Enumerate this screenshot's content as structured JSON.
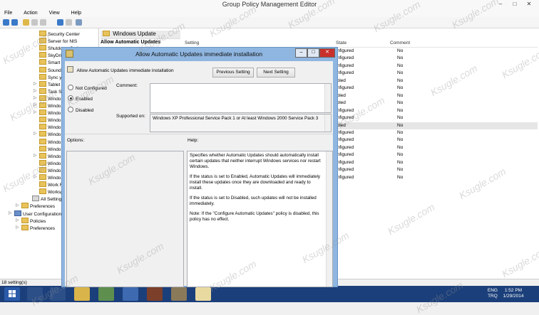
{
  "window": {
    "title": "Group Policy Management Editor",
    "controls": [
      "–",
      "□",
      "✕"
    ]
  },
  "menu": [
    "File",
    "Action",
    "View",
    "Help"
  ],
  "tree": {
    "items": [
      {
        "label": "Security Center"
      },
      {
        "label": "Server for NIS"
      },
      {
        "label": "Shutdown Options"
      },
      {
        "label": "SkyDrive"
      },
      {
        "label": "Smart"
      },
      {
        "label": "Sound"
      },
      {
        "label": "Sync y"
      },
      {
        "label": "Tablet"
      },
      {
        "label": "Task S"
      },
      {
        "label": "Windo"
      },
      {
        "label": "Windo"
      },
      {
        "label": "Windo"
      },
      {
        "label": "Windo"
      },
      {
        "label": "Windo"
      },
      {
        "label": "Windo"
      },
      {
        "label": "Windo"
      },
      {
        "label": "Windo"
      },
      {
        "label": "Windo"
      },
      {
        "label": "Windo"
      },
      {
        "label": "Windo"
      },
      {
        "label": "Windo"
      },
      {
        "label": "Work F"
      },
      {
        "label": "Worksp"
      },
      {
        "label": "All Setting"
      },
      {
        "label": "Preferences"
      },
      {
        "label": "User Configuration"
      },
      {
        "label": "Policies"
      },
      {
        "label": "Preferences"
      }
    ]
  },
  "right": {
    "category": "Windows Update",
    "selected_title": "Allow Automatic Updates",
    "columns": {
      "setting": "Setting",
      "state": "State",
      "comment": "Comment"
    },
    "rows": [
      {
        "state": "onfigured",
        "comment": "No"
      },
      {
        "state": "onfigured",
        "comment": "No"
      },
      {
        "state": "onfigured",
        "comment": "No"
      },
      {
        "state": "onfigured",
        "comment": "No"
      },
      {
        "state": "abled",
        "comment": "No"
      },
      {
        "state": "onfigured",
        "comment": "No"
      },
      {
        "state": "abled",
        "comment": "No"
      },
      {
        "state": "abled",
        "comment": "No"
      },
      {
        "state": "onfigured",
        "comment": "No"
      },
      {
        "state": "onfigured",
        "comment": "No"
      },
      {
        "state": "abled",
        "comment": "No"
      },
      {
        "state": "onfigured",
        "comment": "No"
      },
      {
        "state": "onfigured",
        "comment": "No"
      },
      {
        "state": "onfigured",
        "comment": "No"
      },
      {
        "state": "onfigured",
        "comment": "No"
      },
      {
        "state": "onfigured",
        "comment": "No"
      },
      {
        "state": "onfigured",
        "comment": "No"
      },
      {
        "state": "onfigured",
        "comment": "No"
      }
    ]
  },
  "dialog": {
    "title": "Allow Automatic Updates immediate installation",
    "policy_name": "Allow Automatic Updates immediate installation",
    "prev_button": "Previous Setting",
    "next_button": "Next Setting",
    "options": {
      "not_configured": "Not Configured",
      "enabled": "Enabled",
      "disabled": "Disabled"
    },
    "selected": "enabled",
    "comment_label": "Comment:",
    "supported_label": "Supported on:",
    "supported_value": "Windows XP Professional Service Pack 1 or At least Windows 2000 Service Pack 3",
    "options_label": "Options:",
    "help_label": "Help:",
    "help": [
      "Specifies whether Automatic Updates should automatically install certain updates that neither interrupt Windows services nor restart Windows.",
      "If the status is set to Enabled, Automatic Updates will immediately install these updates once they are downloaded and ready to install.",
      "If the status is set to Disabled, such updates will not be installed immediately.",
      "Note: If the \"Configure Automatic Updates\" policy is disabled, this policy has no effect."
    ]
  },
  "status": "18 setting(s)",
  "taskbar": {
    "lang": "ENG",
    "lang2": "TRQ",
    "time": "1:52 PM",
    "date": "1/29/2014"
  },
  "watermark": "Ksugle.com",
  "colors": {
    "taskbar": "#1b3f7a",
    "dialog_frame": "#8fb6e0",
    "close": "#c9302c"
  }
}
